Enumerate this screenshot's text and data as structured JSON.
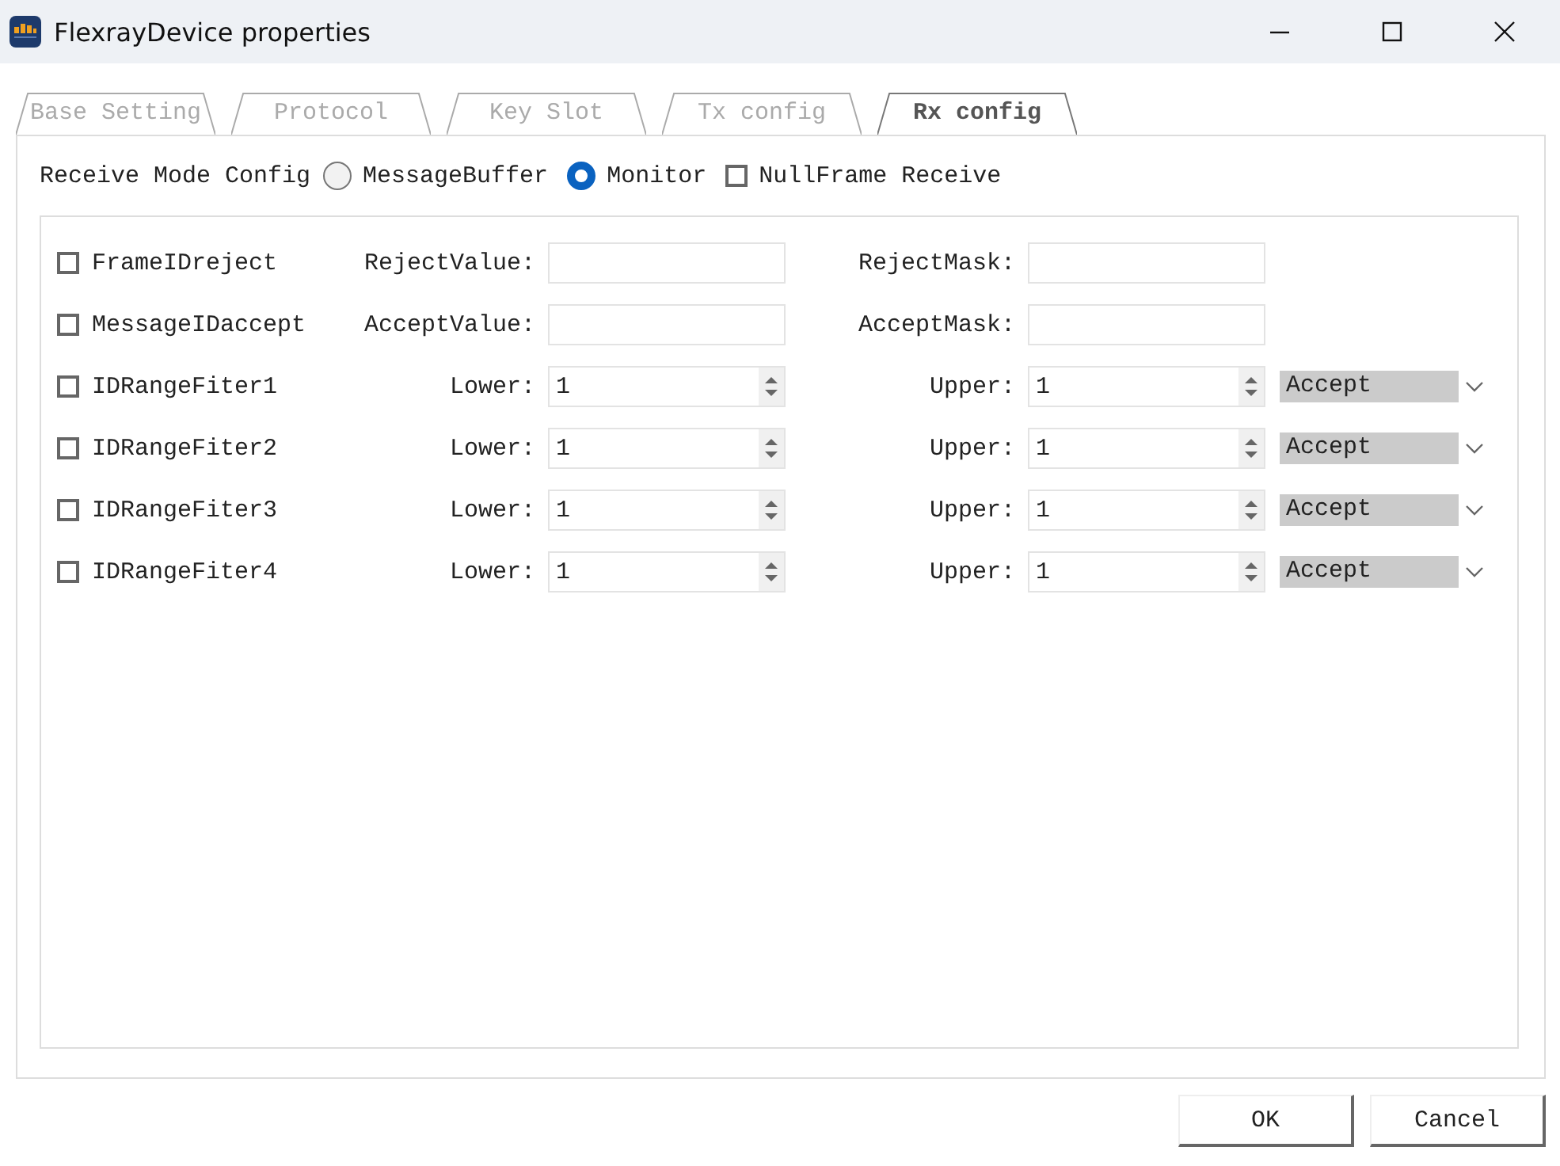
{
  "window": {
    "title": "FlexrayDevice properties"
  },
  "tabs": [
    {
      "label": "Base Setting",
      "selected": false
    },
    {
      "label": "Protocol",
      "selected": false
    },
    {
      "label": "Key Slot",
      "selected": false
    },
    {
      "label": "Tx config",
      "selected": false
    },
    {
      "label": "Rx config",
      "selected": true
    }
  ],
  "receive_mode": {
    "label": "Receive Mode Config",
    "options": [
      {
        "kind": "radio",
        "label": "MessageBuffer",
        "selected": false
      },
      {
        "kind": "radio",
        "label": "Monitor",
        "selected": true
      },
      {
        "kind": "checkbox",
        "label": "NullFrame Receive",
        "checked": false
      }
    ]
  },
  "filters": [
    {
      "kind": "mask",
      "name": "FrameIDreject",
      "checked": false,
      "label_1": "RejectValue:",
      "label_2": "RejectMask:"
    },
    {
      "kind": "mask",
      "name": "MessageIDaccept",
      "checked": false,
      "label_1": "AcceptValue:",
      "label_2": "AcceptMask:"
    },
    {
      "kind": "range",
      "name": "IDRangeFiter1",
      "checked": false,
      "label_1": "Lower:",
      "value_1": "1",
      "label_2": "Upper:",
      "value_2": "1",
      "mode": "Accept"
    },
    {
      "kind": "range",
      "name": "IDRangeFiter2",
      "checked": false,
      "label_1": "Lower:",
      "value_1": "1",
      "label_2": "Upper:",
      "value_2": "1",
      "mode": "Accept"
    },
    {
      "kind": "range",
      "name": "IDRangeFiter3",
      "checked": false,
      "label_1": "Lower:",
      "value_1": "1",
      "label_2": "Upper:",
      "value_2": "1",
      "mode": "Accept"
    },
    {
      "kind": "range",
      "name": "IDRangeFiter4",
      "checked": false,
      "label_1": "Lower:",
      "value_1": "1",
      "label_2": "Upper:",
      "value_2": "1",
      "mode": "Accept"
    }
  ],
  "buttons": [
    "OK",
    "Cancel"
  ]
}
